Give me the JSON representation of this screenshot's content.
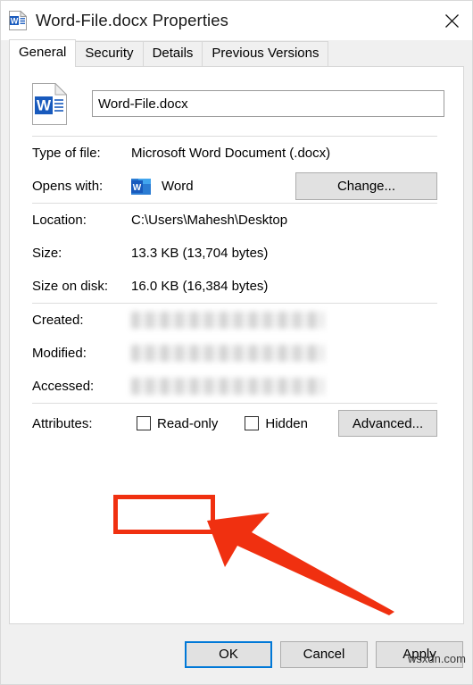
{
  "window": {
    "title": "Word-File.docx Properties",
    "icon": "word-document-icon",
    "close_label": "×"
  },
  "tabs": [
    {
      "label": "General",
      "active": true
    },
    {
      "label": "Security",
      "active": false
    },
    {
      "label": "Details",
      "active": false
    },
    {
      "label": "Previous Versions",
      "active": false
    }
  ],
  "general": {
    "file_icon": "word-document-icon",
    "filename_value": "Word-File.docx",
    "filename_placeholder": "File name",
    "type_of_file": {
      "label": "Type of file:",
      "value": "Microsoft Word Document (.docx)"
    },
    "opens_with": {
      "label": "Opens with:",
      "app_icon": "word-app-icon",
      "app_name": "Word",
      "change_button": "Change..."
    },
    "location": {
      "label": "Location:",
      "value": "C:\\Users\\Mahesh\\Desktop"
    },
    "size": {
      "label": "Size:",
      "value": "13.3 KB (13,704 bytes)"
    },
    "size_on_disk": {
      "label": "Size on disk:",
      "value": "16.0 KB (16,384 bytes)"
    },
    "created": {
      "label": "Created:",
      "value": ""
    },
    "modified": {
      "label": "Modified:",
      "value": ""
    },
    "accessed": {
      "label": "Accessed:",
      "value": ""
    },
    "attributes": {
      "label": "Attributes:",
      "readonly_label": "Read-only",
      "readonly_checked": false,
      "hidden_label": "Hidden",
      "hidden_checked": false,
      "advanced_button": "Advanced..."
    }
  },
  "footer": {
    "ok": "OK",
    "cancel": "Cancel",
    "apply": "Apply"
  },
  "annotations": {
    "highlight_color": "#f03010",
    "arrow_color": "#f03010",
    "highlight_target": "Read-only"
  },
  "watermark": "wsxdn.com"
}
